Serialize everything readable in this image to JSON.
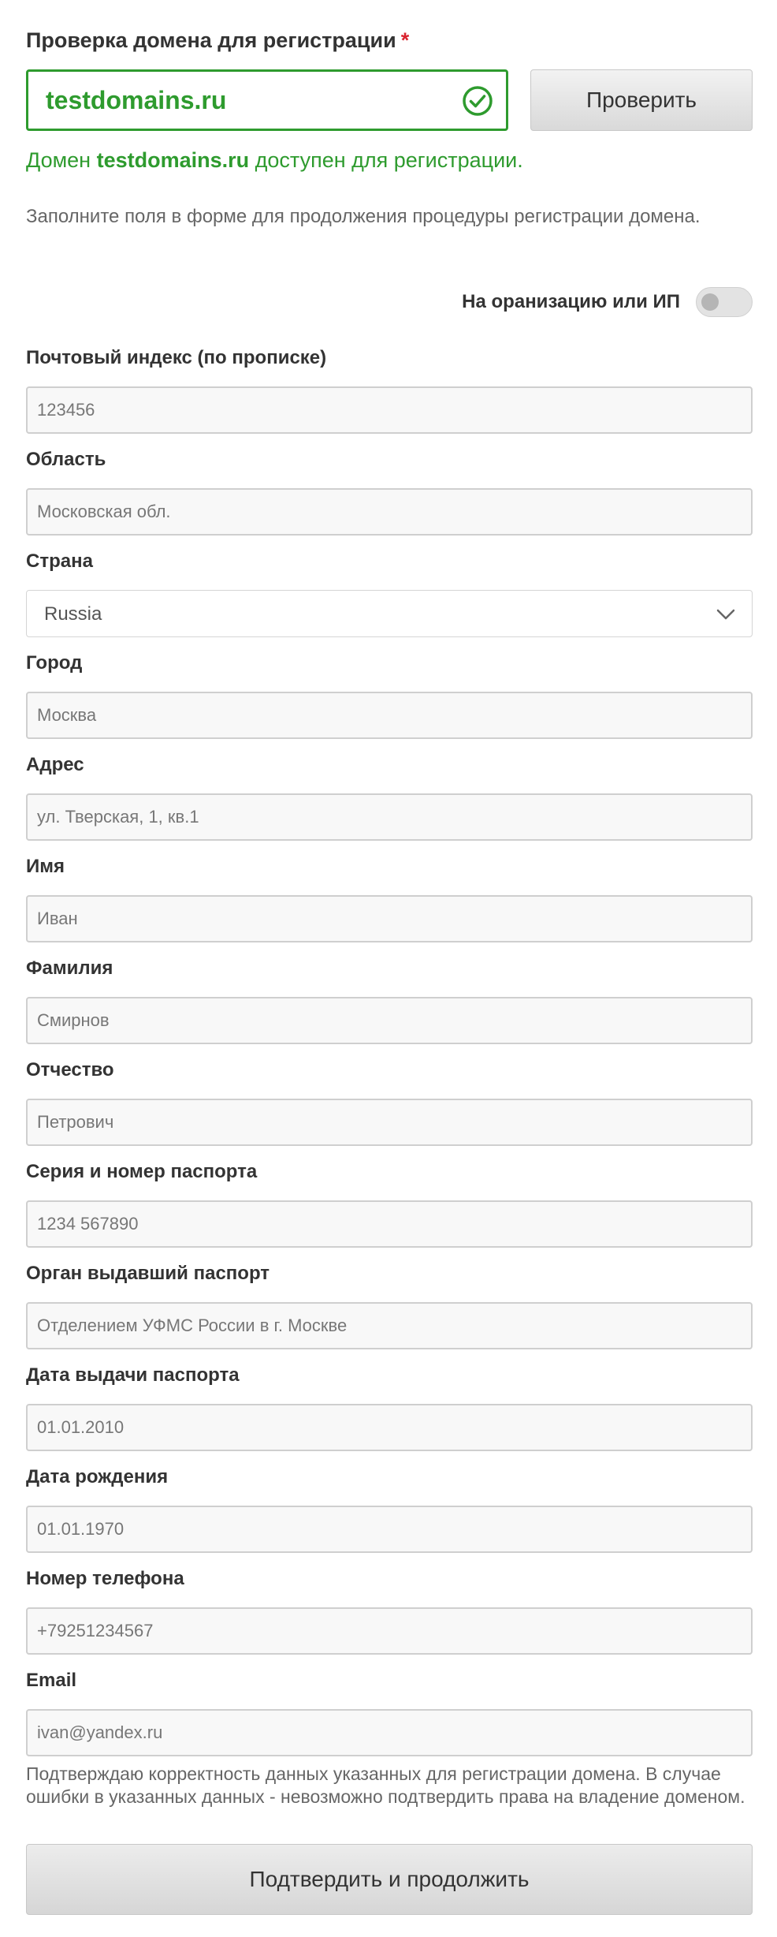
{
  "domain_check": {
    "title": "Проверка домена для регистрации",
    "required_mark": "*",
    "value": "testdomains.ru",
    "button_label": "Проверить",
    "status_prefix": "Домен ",
    "status_domain": "testdomains.ru",
    "status_suffix": " доступен для регистрации.",
    "status_color": "#2e9b2e"
  },
  "intro_text": "Заполните поля в форме для продолжения процедуры регистрации домена.",
  "toggle": {
    "label": "На оранизацию или ИП",
    "checked": false
  },
  "fields": {
    "postal": {
      "label": "Почтовый индекс (по прописке)",
      "placeholder": "123456"
    },
    "region": {
      "label": "Область",
      "placeholder": "Московская обл."
    },
    "country": {
      "label": "Страна",
      "value": "Russia"
    },
    "city": {
      "label": "Город",
      "placeholder": "Москва"
    },
    "address": {
      "label": "Адрес",
      "placeholder": "ул. Тверская, 1, кв.1"
    },
    "first_name": {
      "label": "Имя",
      "placeholder": "Иван"
    },
    "last_name": {
      "label": "Фамилия",
      "placeholder": "Смирнов"
    },
    "patronymic": {
      "label": "Отчество",
      "placeholder": "Петрович"
    },
    "passport_number": {
      "label": "Серия и номер паспорта",
      "placeholder": "1234 567890"
    },
    "passport_issuer": {
      "label": "Орган выдавший паспорт",
      "placeholder": "Отделением УФМС России в г. Москве"
    },
    "passport_date": {
      "label": "Дата выдачи паспорта",
      "placeholder": "01.01.2010"
    },
    "birth_date": {
      "label": "Дата рождения",
      "placeholder": "01.01.1970"
    },
    "phone": {
      "label": "Номер телефона",
      "placeholder": "+79251234567"
    },
    "email": {
      "label": "Email",
      "placeholder": "ivan@yandex.ru"
    }
  },
  "confirm_note": "Подтверждаю корректность данных указанных для регистрации домена. В случае ошибки в указанных данных - невозможно подтвердить права на владение доменом.",
  "submit_label": "Подтвердить и продолжить",
  "icons": {
    "check": "check-circle-icon",
    "chevron": "chevron-down-icon"
  }
}
